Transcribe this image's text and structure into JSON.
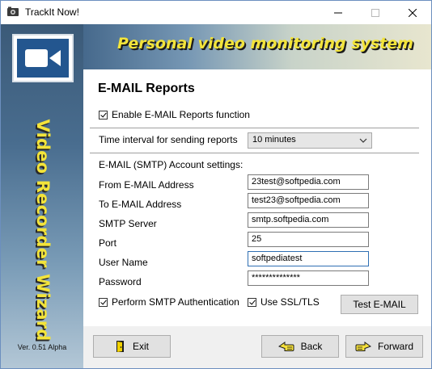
{
  "window": {
    "title": "TrackIt Now!",
    "controls": {
      "minimize": "minimize-icon",
      "maximize": "maximize-icon",
      "close": "close-icon"
    }
  },
  "banner": {
    "vertical_title": "Video Recorder Wizard",
    "version": "Ver. 0.51 Alpha",
    "icon": "video-camera-icon"
  },
  "header": {
    "title": "Personal video monitoring system"
  },
  "page": {
    "heading": "E-MAIL Reports",
    "enable_reports": {
      "label": "Enable E-MAIL Reports function",
      "checked": true
    },
    "interval": {
      "label": "Time interval for sending reports",
      "value": "10 minutes"
    },
    "smtp_section_label": "E-MAIL (SMTP) Account settings:",
    "fields": {
      "from": {
        "label": "From E-MAIL Address",
        "value": "23test@softpedia.com"
      },
      "to": {
        "label": "To E-MAIL Address",
        "value": "test23@softpedia.com"
      },
      "server": {
        "label": "SMTP Server",
        "value": "smtp.softpedia.com"
      },
      "port": {
        "label": "Port",
        "value": "25"
      },
      "user": {
        "label": "User Name",
        "value": "softpediatest"
      },
      "password": {
        "label": "Password",
        "value": "**************"
      }
    },
    "smtp_auth": {
      "label": "Perform SMTP Authentication",
      "checked": true
    },
    "ssl": {
      "label": "Use SSL/TLS",
      "checked": true
    },
    "test_button": "Test E-MAIL"
  },
  "footer": {
    "exit": "Exit",
    "back": "Back",
    "forward": "Forward"
  },
  "colors": {
    "banner_text": "#f3e43a",
    "banner_dark": "#3b5a78",
    "focus_border": "#2f6fb3"
  }
}
